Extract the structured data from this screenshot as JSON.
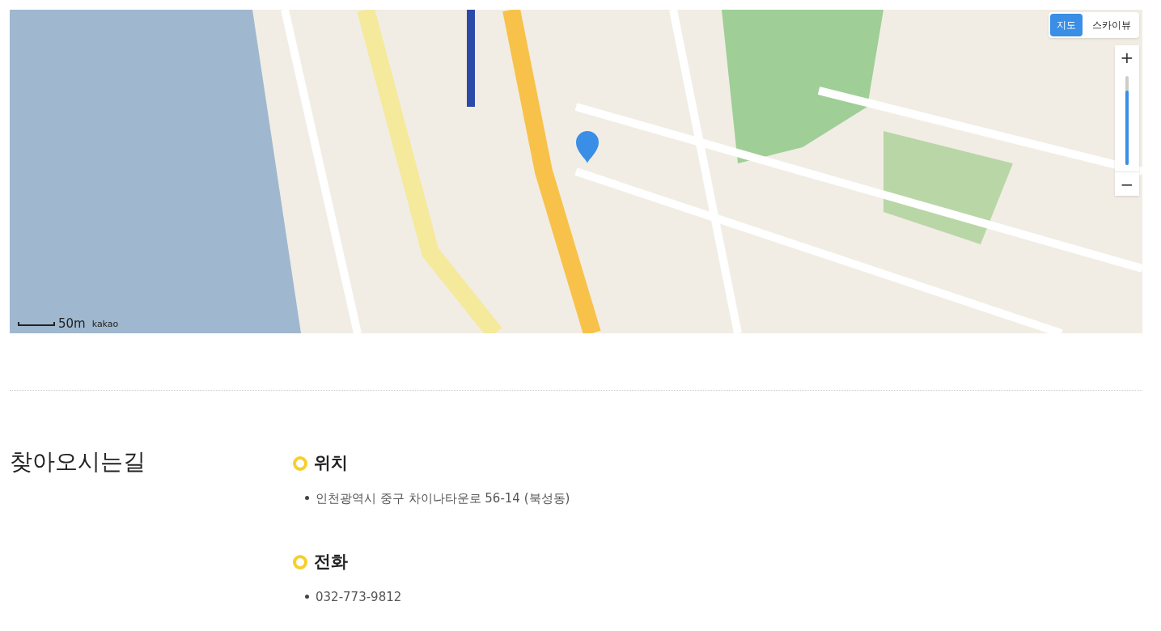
{
  "map": {
    "map_types": [
      {
        "label": "지도",
        "selected": true
      },
      {
        "label": "스카이뷰",
        "selected": false
      }
    ],
    "zoom": {
      "in_label": "+",
      "out_label": "−",
      "level": 0.84
    },
    "scale": "50m",
    "attribution": "kakao"
  },
  "directions": {
    "title": "찾아오시는길",
    "sections": [
      {
        "heading": "위치",
        "items": [
          "인천광역시 중구 차이나타운로 56-14 (북성동)"
        ]
      },
      {
        "heading": "전화",
        "items": [
          "032-773-9812"
        ]
      }
    ]
  }
}
